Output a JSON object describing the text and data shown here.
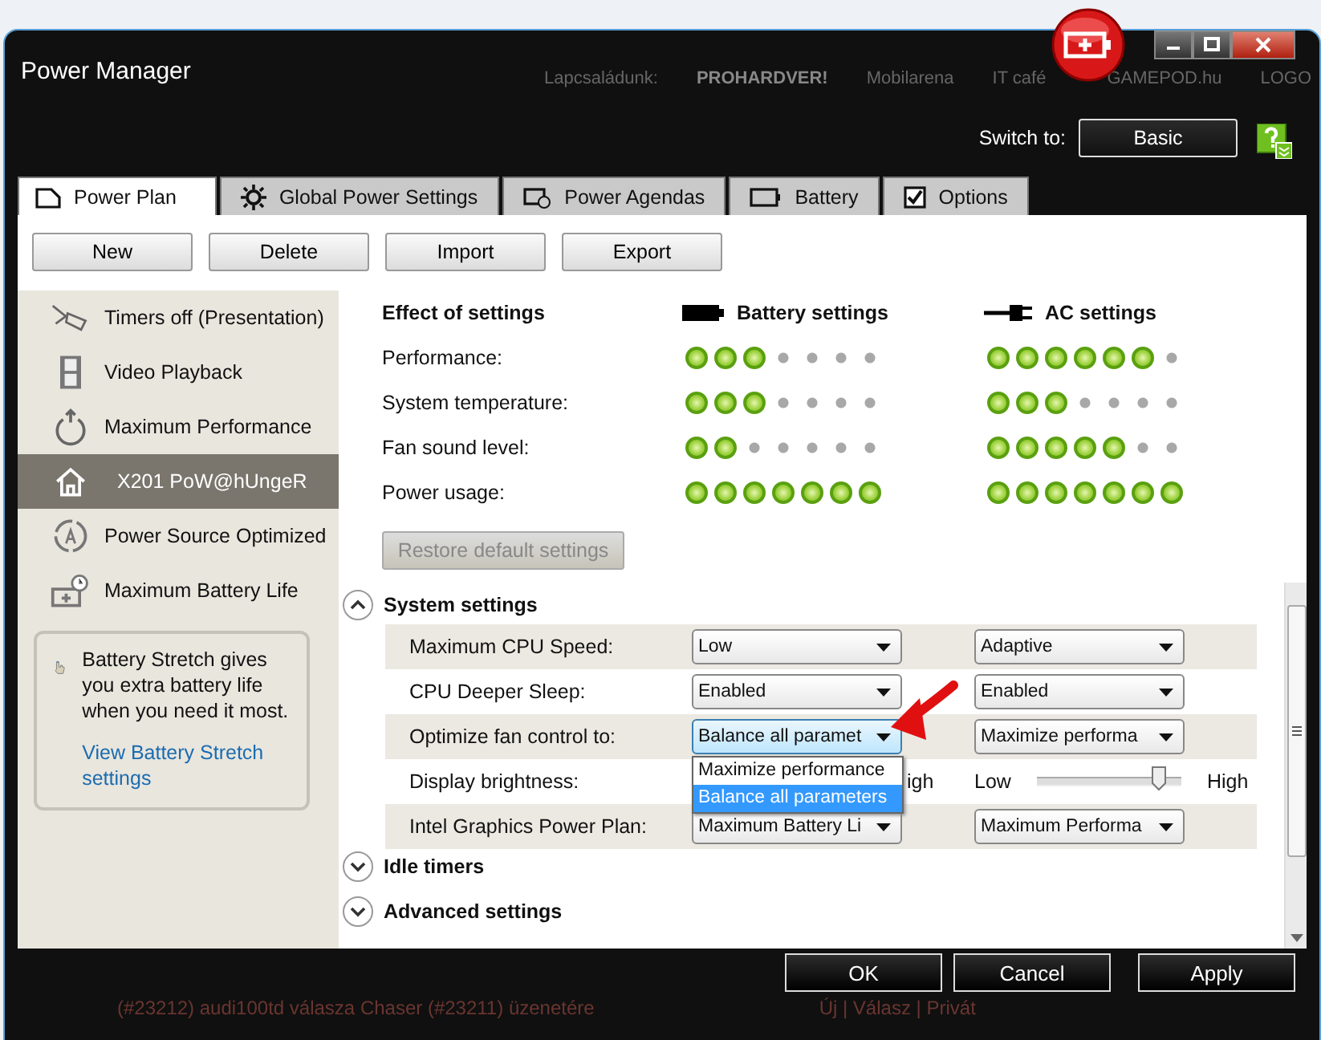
{
  "window": {
    "title": "Power Manager"
  },
  "background_links": [
    "Lapcsaládunk:",
    "PROHARDVER!",
    "Mobilarena",
    "IT café",
    "GAMEPOD.hu",
    "LOGO"
  ],
  "switch": {
    "label": "Switch to:",
    "button": "Basic"
  },
  "tabs": [
    {
      "label": "Power Plan",
      "selected": true
    },
    {
      "label": "Global Power Settings",
      "selected": false
    },
    {
      "label": "Power Agendas",
      "selected": false
    },
    {
      "label": "Battery",
      "selected": false
    },
    {
      "label": "Options",
      "selected": false
    }
  ],
  "plan_buttons": [
    "New",
    "Delete",
    "Import",
    "Export"
  ],
  "plans": [
    {
      "kind": "presentation",
      "label": "Timers off (Presentation)",
      "selected": false
    },
    {
      "kind": "video",
      "label": "Video Playback",
      "selected": false
    },
    {
      "kind": "performance",
      "label": "Maximum Performance",
      "selected": false
    },
    {
      "kind": "home",
      "label": "X201 PoW@hUngeR",
      "selected": true
    },
    {
      "kind": "optimized",
      "label": "Power Source Optimized",
      "selected": false
    },
    {
      "kind": "battery",
      "label": "Maximum Battery Life",
      "selected": false
    }
  ],
  "stretch_tip": {
    "text": "Battery Stretch gives you extra battery life when you need it most.",
    "link": "View Battery Stretch settings"
  },
  "effects": {
    "title": "Effect of settings",
    "battery_heading": "Battery settings",
    "ac_heading": "AC settings",
    "rows": [
      {
        "label": "Performance:",
        "battery": {
          "stars": 3
        },
        "ac": {
          "stars": 6
        }
      },
      {
        "label": "System temperature:",
        "battery": {
          "stars": 3
        },
        "ac": {
          "stars": 3
        }
      },
      {
        "label": "Fan sound level:",
        "battery": {
          "stars": 2
        },
        "ac": {
          "stars": 5
        }
      },
      {
        "label": "Power usage:",
        "battery": {
          "stars": 7
        },
        "ac": {
          "stars": 7
        }
      }
    ]
  },
  "restore_button": {
    "label": "Restore default settings",
    "disabled": true
  },
  "sections": [
    {
      "title": "System settings",
      "expanded": true,
      "settings": [
        {
          "label": "Maximum CPU Speed:",
          "battery": {
            "kind": "select",
            "value": "Low",
            "focused": false
          },
          "ac": {
            "kind": "select",
            "value": "Adaptive",
            "focused": false
          }
        },
        {
          "label": "CPU Deeper Sleep:",
          "battery": {
            "kind": "select",
            "value": "Enabled",
            "focused": false
          },
          "ac": {
            "kind": "select",
            "value": "Enabled",
            "focused": false
          }
        },
        {
          "label": "Optimize fan control to:",
          "battery": {
            "kind": "select",
            "value": "Balance all paramet",
            "focused": true,
            "options": [
              {
                "label": "Maximize performance",
                "selected": false
              },
              {
                "label": "Balance all parameters",
                "selected": true
              }
            ]
          },
          "ac": {
            "kind": "select",
            "value": "Maximize performa",
            "focused": false
          }
        },
        {
          "label": "Display brightness:",
          "battery": {
            "kind": "covered",
            "high": "igh"
          },
          "ac": {
            "kind": "slider",
            "low": "Low",
            "high": "High",
            "level": 0.85
          }
        },
        {
          "label": "Intel Graphics Power Plan:",
          "battery": {
            "kind": "select",
            "value": "Maximum Battery Li",
            "focused": false
          },
          "ac": {
            "kind": "select",
            "value": "Maximum Performa",
            "focused": false
          }
        }
      ]
    },
    {
      "title": "Idle timers",
      "expanded": false
    },
    {
      "title": "Advanced settings",
      "expanded": false
    }
  ],
  "dialog_buttons": [
    "OK",
    "Cancel",
    "Apply"
  ],
  "background_post": {
    "text": "(#23212) audi100td válasza Chaser (#23211) üzenetére",
    "actions": "Új | Válasz | Privát"
  }
}
